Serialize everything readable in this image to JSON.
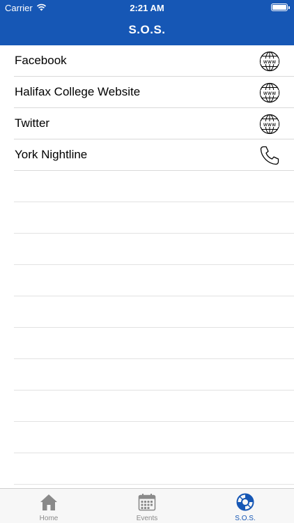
{
  "status_bar": {
    "carrier": "Carrier",
    "time": "2:21 AM"
  },
  "nav": {
    "title": "S.O.S."
  },
  "list": {
    "items": [
      {
        "label": "Facebook",
        "icon": "globe-www-icon"
      },
      {
        "label": "Halifax College Website",
        "icon": "globe-www-icon"
      },
      {
        "label": "Twitter",
        "icon": "globe-www-icon"
      },
      {
        "label": "York Nightline",
        "icon": "phone-icon"
      }
    ]
  },
  "tabbar": {
    "tabs": [
      {
        "label": "Home",
        "icon": "home-icon",
        "active": false
      },
      {
        "label": "Events",
        "icon": "calendar-icon",
        "active": false
      },
      {
        "label": "S.O.S.",
        "icon": "lifebuoy-icon",
        "active": true
      }
    ]
  },
  "colors": {
    "accent": "#1657b5",
    "inactive": "#8a8a8a"
  }
}
